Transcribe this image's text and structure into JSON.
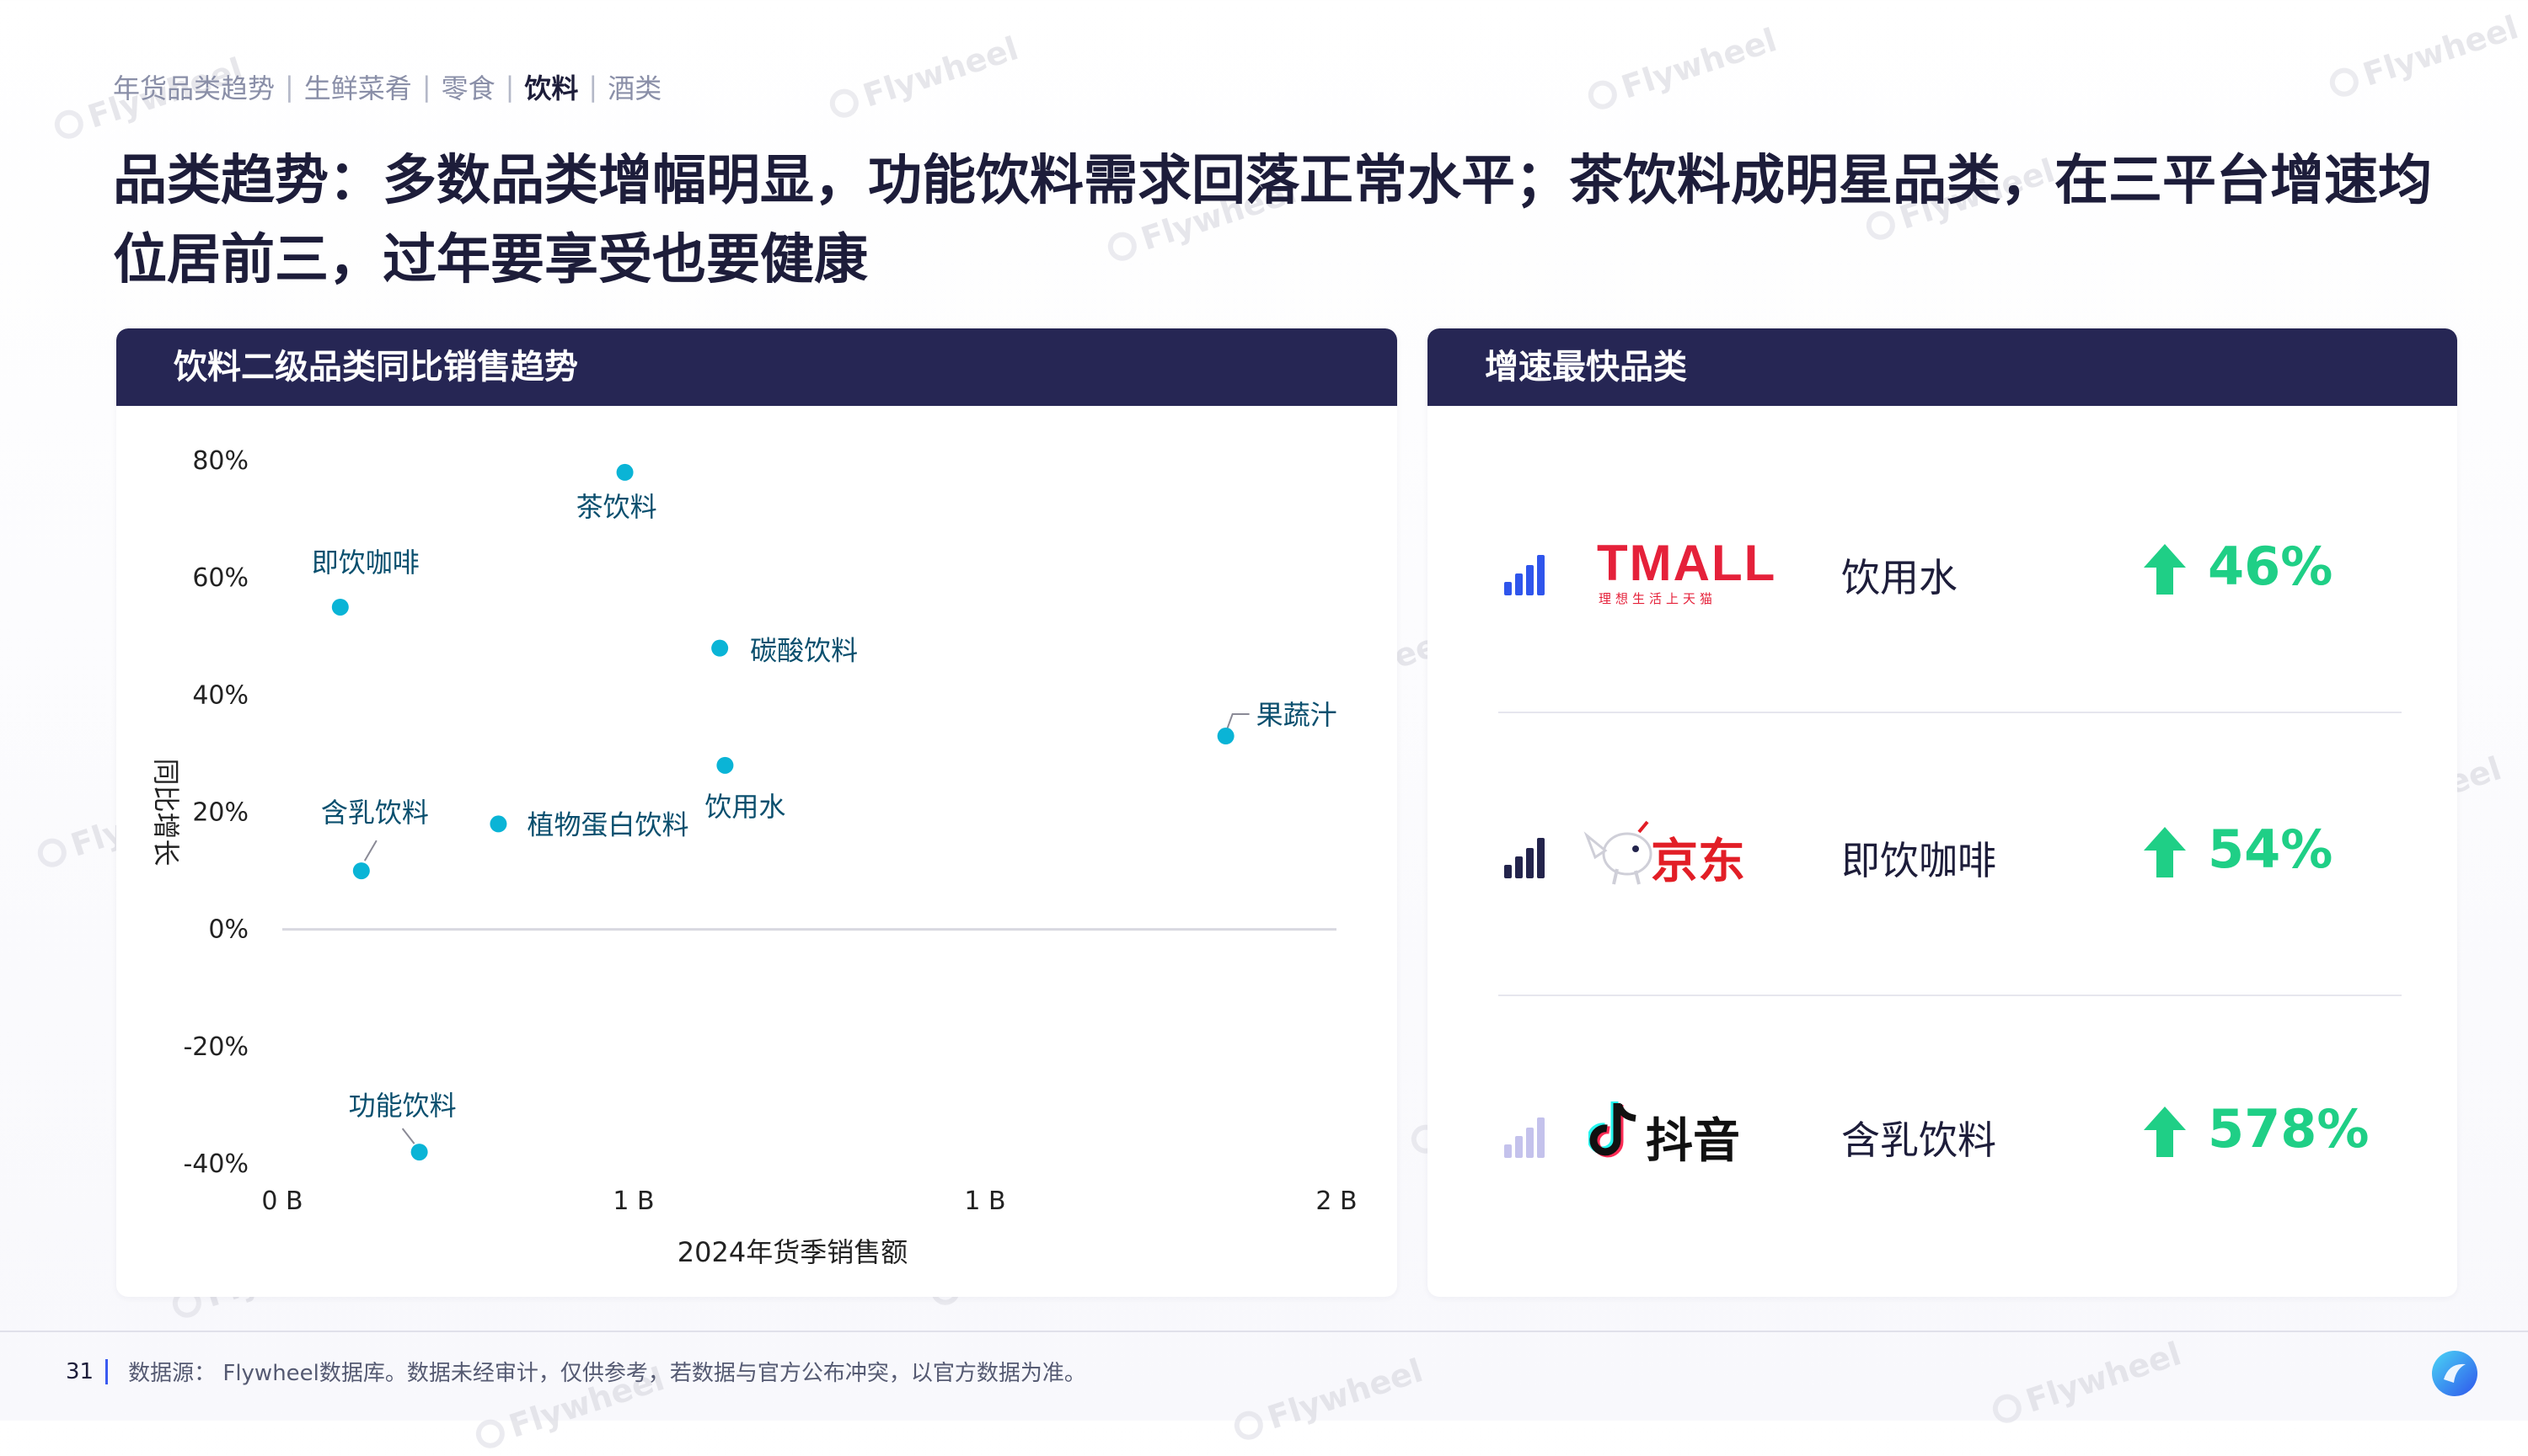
{
  "breadcrumb": [
    "年货品类趋势",
    "生鲜菜肴",
    "零食",
    "饮料",
    "酒类"
  ],
  "breadcrumb_active": 3,
  "title": "品类趋势：多数品类增幅明显，功能饮料需求回落正常水平；茶饮料成明星品类，在三平台增速均位居前三，过年要享受也要健康",
  "left_panel": {
    "header": "饮料二级品类同比销售趋势"
  },
  "right_panel": {
    "header": "增速最快品类"
  },
  "chart_data": {
    "type": "scatter",
    "xlabel": "2024年货季销售额",
    "ylabel": "同比增长",
    "y_ticks": [
      "80%",
      "60%",
      "40%",
      "20%",
      "0%",
      "-20%",
      "-40%"
    ],
    "y_tick_values": [
      80,
      60,
      40,
      20,
      0,
      -20,
      -40
    ],
    "x_ticks": [
      "0 B",
      "1 B",
      "1 B",
      "2 B"
    ],
    "ylim": [
      -40,
      80
    ],
    "xlim": [
      0,
      2
    ],
    "grid": false,
    "points": [
      {
        "label": "茶饮料",
        "x": 0.65,
        "y": 78
      },
      {
        "label": "即饮咖啡",
        "x": 0.11,
        "y": 55
      },
      {
        "label": "碳酸饮料",
        "x": 0.83,
        "y": 48
      },
      {
        "label": "果蔬汁",
        "x": 1.79,
        "y": 33
      },
      {
        "label": "饮用水",
        "x": 0.84,
        "y": 28
      },
      {
        "label": "含乳饮料",
        "x": 0.15,
        "y": 10
      },
      {
        "label": "植物蛋白饮料",
        "x": 0.41,
        "y": 18
      },
      {
        "label": "功能饮料",
        "x": 0.26,
        "y": -38
      }
    ],
    "point_color": "#0ab4d6"
  },
  "fastest": [
    {
      "platform": "TMALL",
      "platform_sub": "理想生活上天猫",
      "category": "饮用水",
      "growth": "46%",
      "bar_color": "#2f55ec"
    },
    {
      "platform": "京东",
      "category": "即饮咖啡",
      "growth": "54%",
      "bar_color": "#23244c"
    },
    {
      "platform": "抖音",
      "category": "含乳饮料",
      "growth": "578%",
      "bar_color": "#c4c2ec"
    }
  ],
  "colors": {
    "header_bg": "#262654",
    "growth": "#1fcf86",
    "tmall_red": "#e5213a",
    "jd_red": "#e21e26"
  },
  "watermark": "Flywheel",
  "footer": {
    "page": "31",
    "source": "数据源： Flywheel数据库。数据未经审计，仅供参考，若数据与官方公布冲突，以官方数据为准。"
  }
}
